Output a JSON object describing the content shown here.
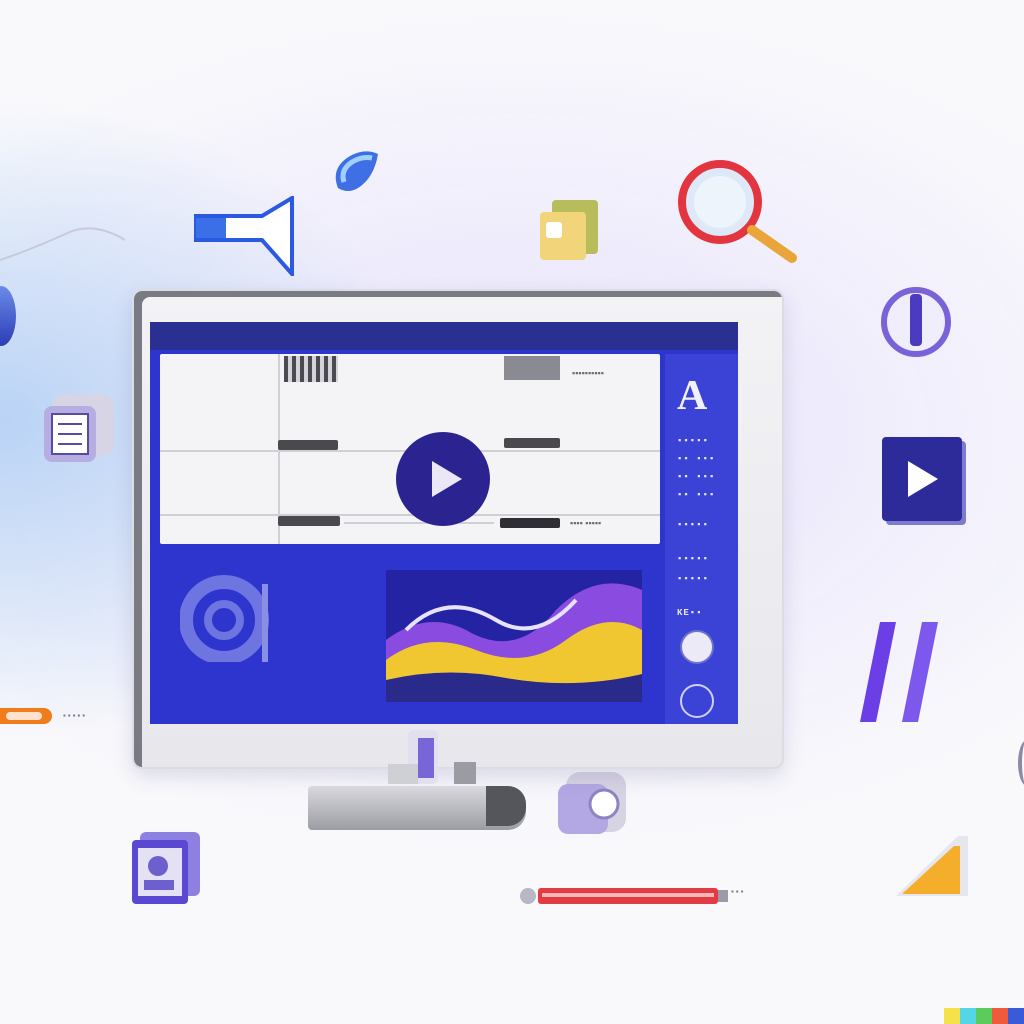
{
  "screen": {
    "labels": {
      "row1": "▪▪▪▪▪▪▪▪▪▪",
      "row3": "▪▪▪▪ ▪▪▪▪▪"
    },
    "side_panel": {
      "letter": "A",
      "rows": [
        "▪▪▪▪▪",
        "▪▪ ▪▪▪",
        "▪▪ ▪▪▪",
        "▪▪ ▪▪▪",
        "▪▪▪▪▪",
        "▪▪▪▪▪",
        "▪▪▪▪▪",
        "KE▪▪"
      ]
    }
  },
  "floating": {
    "slider_left_label": "▪▪▪▪▪",
    "pen_label": "▪▪▪"
  },
  "colors": {
    "screen_blue": "#2e35cf",
    "navy": "#2a2390",
    "accent_yellow": "#f0c731",
    "accent_red": "#e23b43",
    "accent_orange": "#f07c1c",
    "purple": "#6b55e0"
  },
  "palette": [
    "#f5e14a",
    "#55d6e6",
    "#5bcb5b",
    "#ef5a3c",
    "#3a5bd8"
  ]
}
